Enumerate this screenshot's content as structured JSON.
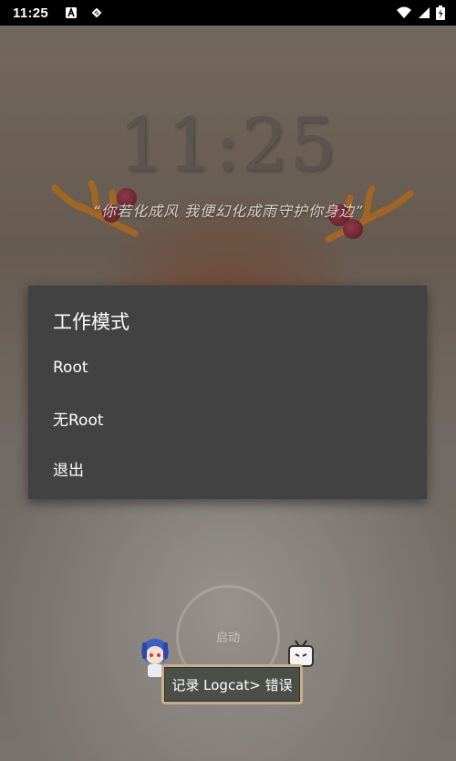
{
  "status_bar": {
    "time": "11:25",
    "icons": [
      "a-notification-icon",
      "sim-card-icon",
      "wifi-icon",
      "signal-icon",
      "battery-charging-icon"
    ]
  },
  "lock": {
    "clock": "11:25",
    "motto": "“你若化成风  我便幻化成雨守护你身边”"
  },
  "dialog": {
    "title": "工作模式",
    "options": [
      {
        "label": "Root"
      },
      {
        "label": "无Root"
      },
      {
        "label": "退出"
      }
    ]
  },
  "main": {
    "start_label": "启动",
    "logcat_button": "记录 Logcat> 错误"
  },
  "colors": {
    "dialog_bg": "#424242",
    "status_bar": "#000000",
    "button_frame": "#c9ad8b",
    "button_fill": "#4a5048"
  }
}
